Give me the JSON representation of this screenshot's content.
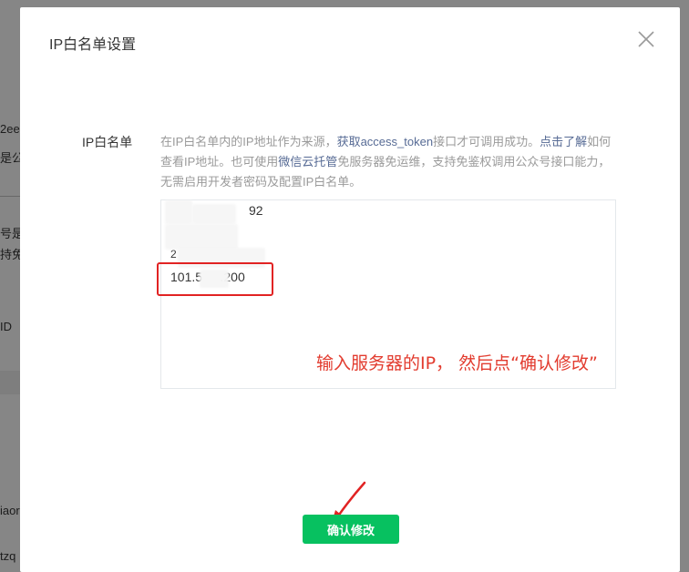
{
  "background": {
    "fragments": [
      "2ee",
      "是公",
      "号是t",
      "持免",
      "ID",
      "iaor",
      "tzq"
    ]
  },
  "dialog": {
    "title": "IP白名单设置",
    "close_icon": "close-icon"
  },
  "form": {
    "label": "IP白名单",
    "description": {
      "text1": "在IP白名单内的IP地址作为来源，",
      "link1": "获取access_token",
      "text2": "接口才可调用成功。",
      "link2": "点击了解",
      "text3": "如何查看IP地址。也可使用",
      "link3": "微信云托管",
      "text4": "免服务器免运维，支持免鉴权调用公众号接口能力，无需启用开发者密码及配置IP白名单。"
    },
    "ip_entries": [
      "92",
      "2",
      "101.5     .200"
    ]
  },
  "annotation": {
    "text": "输入服务器的IP， 然后点“确认修改”",
    "color": "#e23b2e"
  },
  "confirm_button": {
    "label": "确认修改",
    "color": "#07c160"
  }
}
